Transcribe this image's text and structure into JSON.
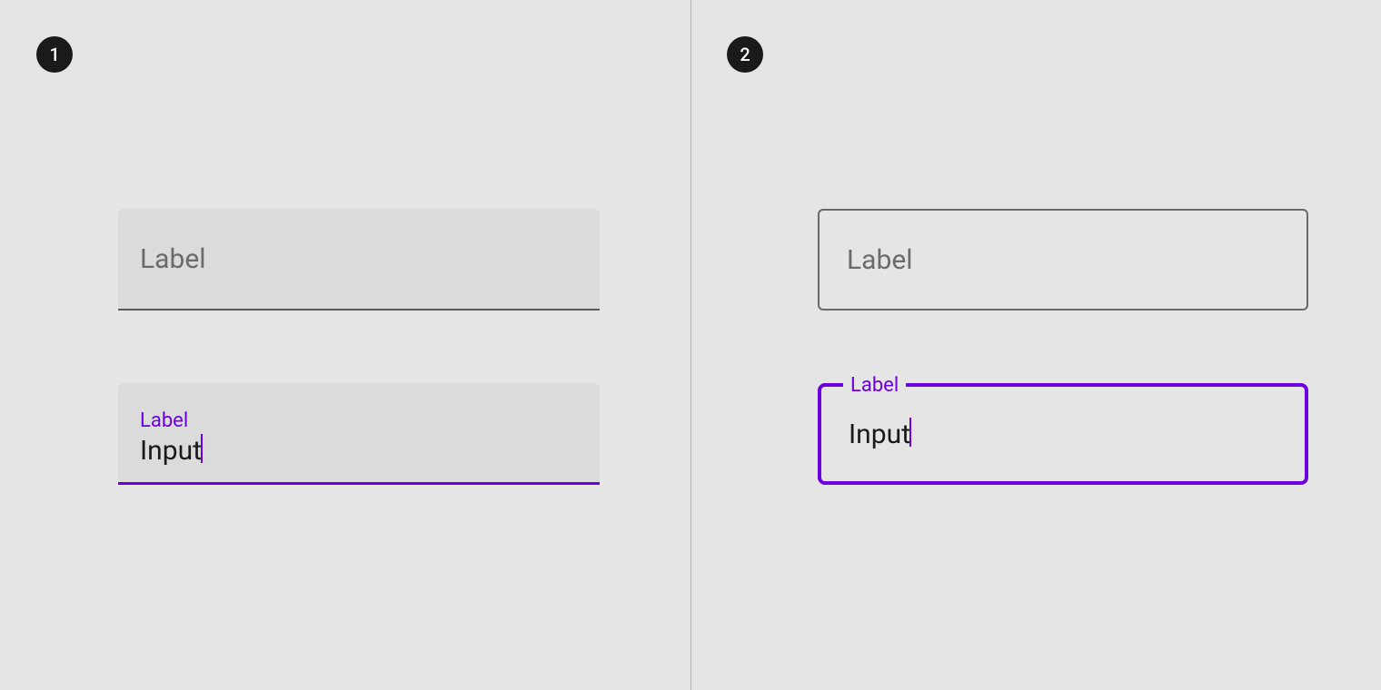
{
  "panels": {
    "left": {
      "badge": "1",
      "inactive_label": "Label",
      "active_label": "Label",
      "active_input": "Input"
    },
    "right": {
      "badge": "2",
      "inactive_label": "Label",
      "active_label": "Label",
      "active_input": "Input"
    }
  },
  "colors": {
    "accent": "#6c00df",
    "badge_bg": "#1a1a1a",
    "background": "#e5e5e5",
    "filled_bg": "#dbdbdb",
    "label_gray": "#6a6a6a"
  }
}
